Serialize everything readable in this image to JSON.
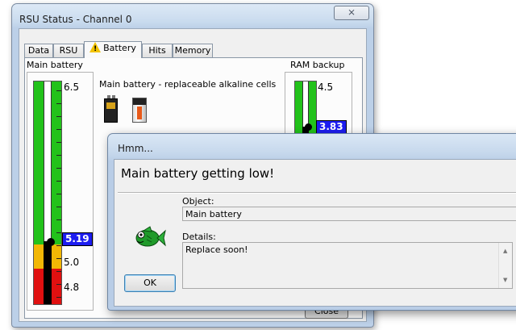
{
  "window": {
    "title": "RSU Status - Channel 0",
    "close_glyph": "⨯"
  },
  "tabs": [
    {
      "label": "Data"
    },
    {
      "label": "RSU"
    },
    {
      "label": "Battery",
      "icon": "warning-icon"
    },
    {
      "label": "Hits"
    },
    {
      "label": "Memory"
    }
  ],
  "battery": {
    "main_label": "Main battery",
    "description": "Main battery - replaceable alkaline cells",
    "main_gauge": {
      "max": "6.5",
      "mid": "5.0",
      "min": "4.8",
      "value": "5.19"
    },
    "ram_label": "RAM backup",
    "ram_gauge": {
      "max": "4.5",
      "value": "3.83"
    },
    "colors": {
      "ok": "#22c21a",
      "warn": "#f2b705",
      "low": "#e01010",
      "value_box": "#1d1df0"
    }
  },
  "close_button": "Close",
  "dialog": {
    "title": "Hmm...",
    "message": "Main battery getting low!",
    "object_label": "Object:",
    "object_value": "Main battery",
    "details_label": "Details:",
    "details_value": "Replace soon!",
    "ok_button": "OK",
    "icon": "fish-icon"
  }
}
